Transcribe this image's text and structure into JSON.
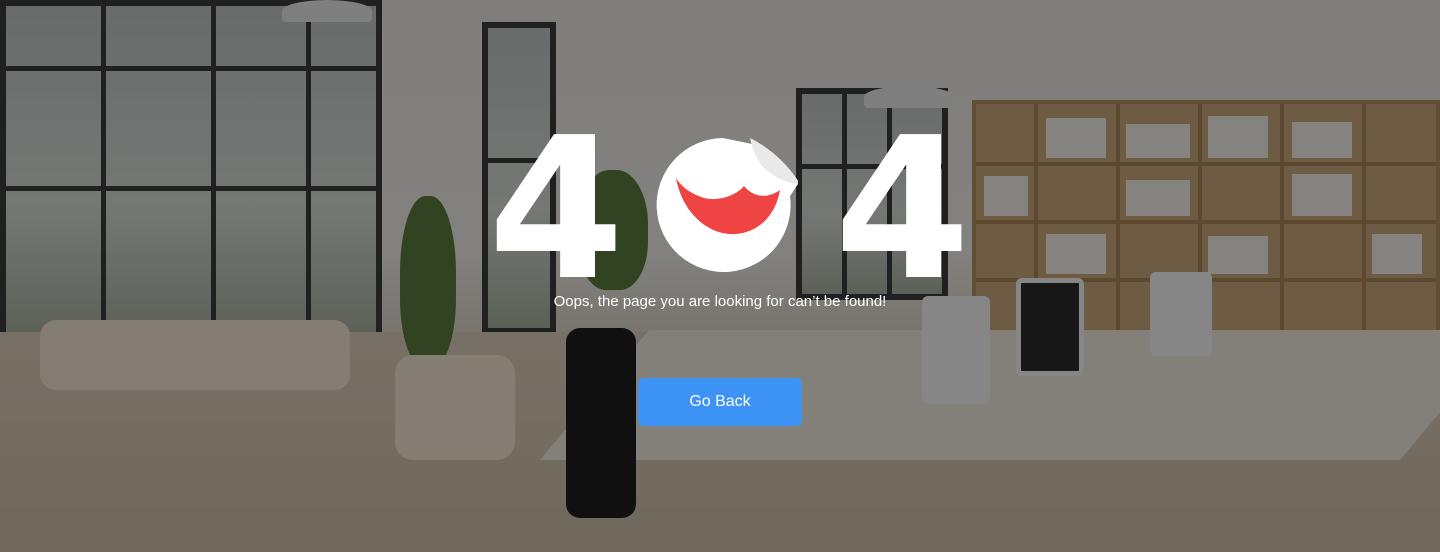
{
  "error": {
    "digit_left": "4",
    "digit_right": "4",
    "middle_icon": "sad-face-sticker-icon",
    "message": "Oops, the page you are looking for can’t be found!"
  },
  "actions": {
    "go_back_label": "Go Back"
  },
  "colors": {
    "accent_button": "#3d93f5",
    "sticker_mouth": "#ef4444",
    "text": "#ffffff"
  }
}
